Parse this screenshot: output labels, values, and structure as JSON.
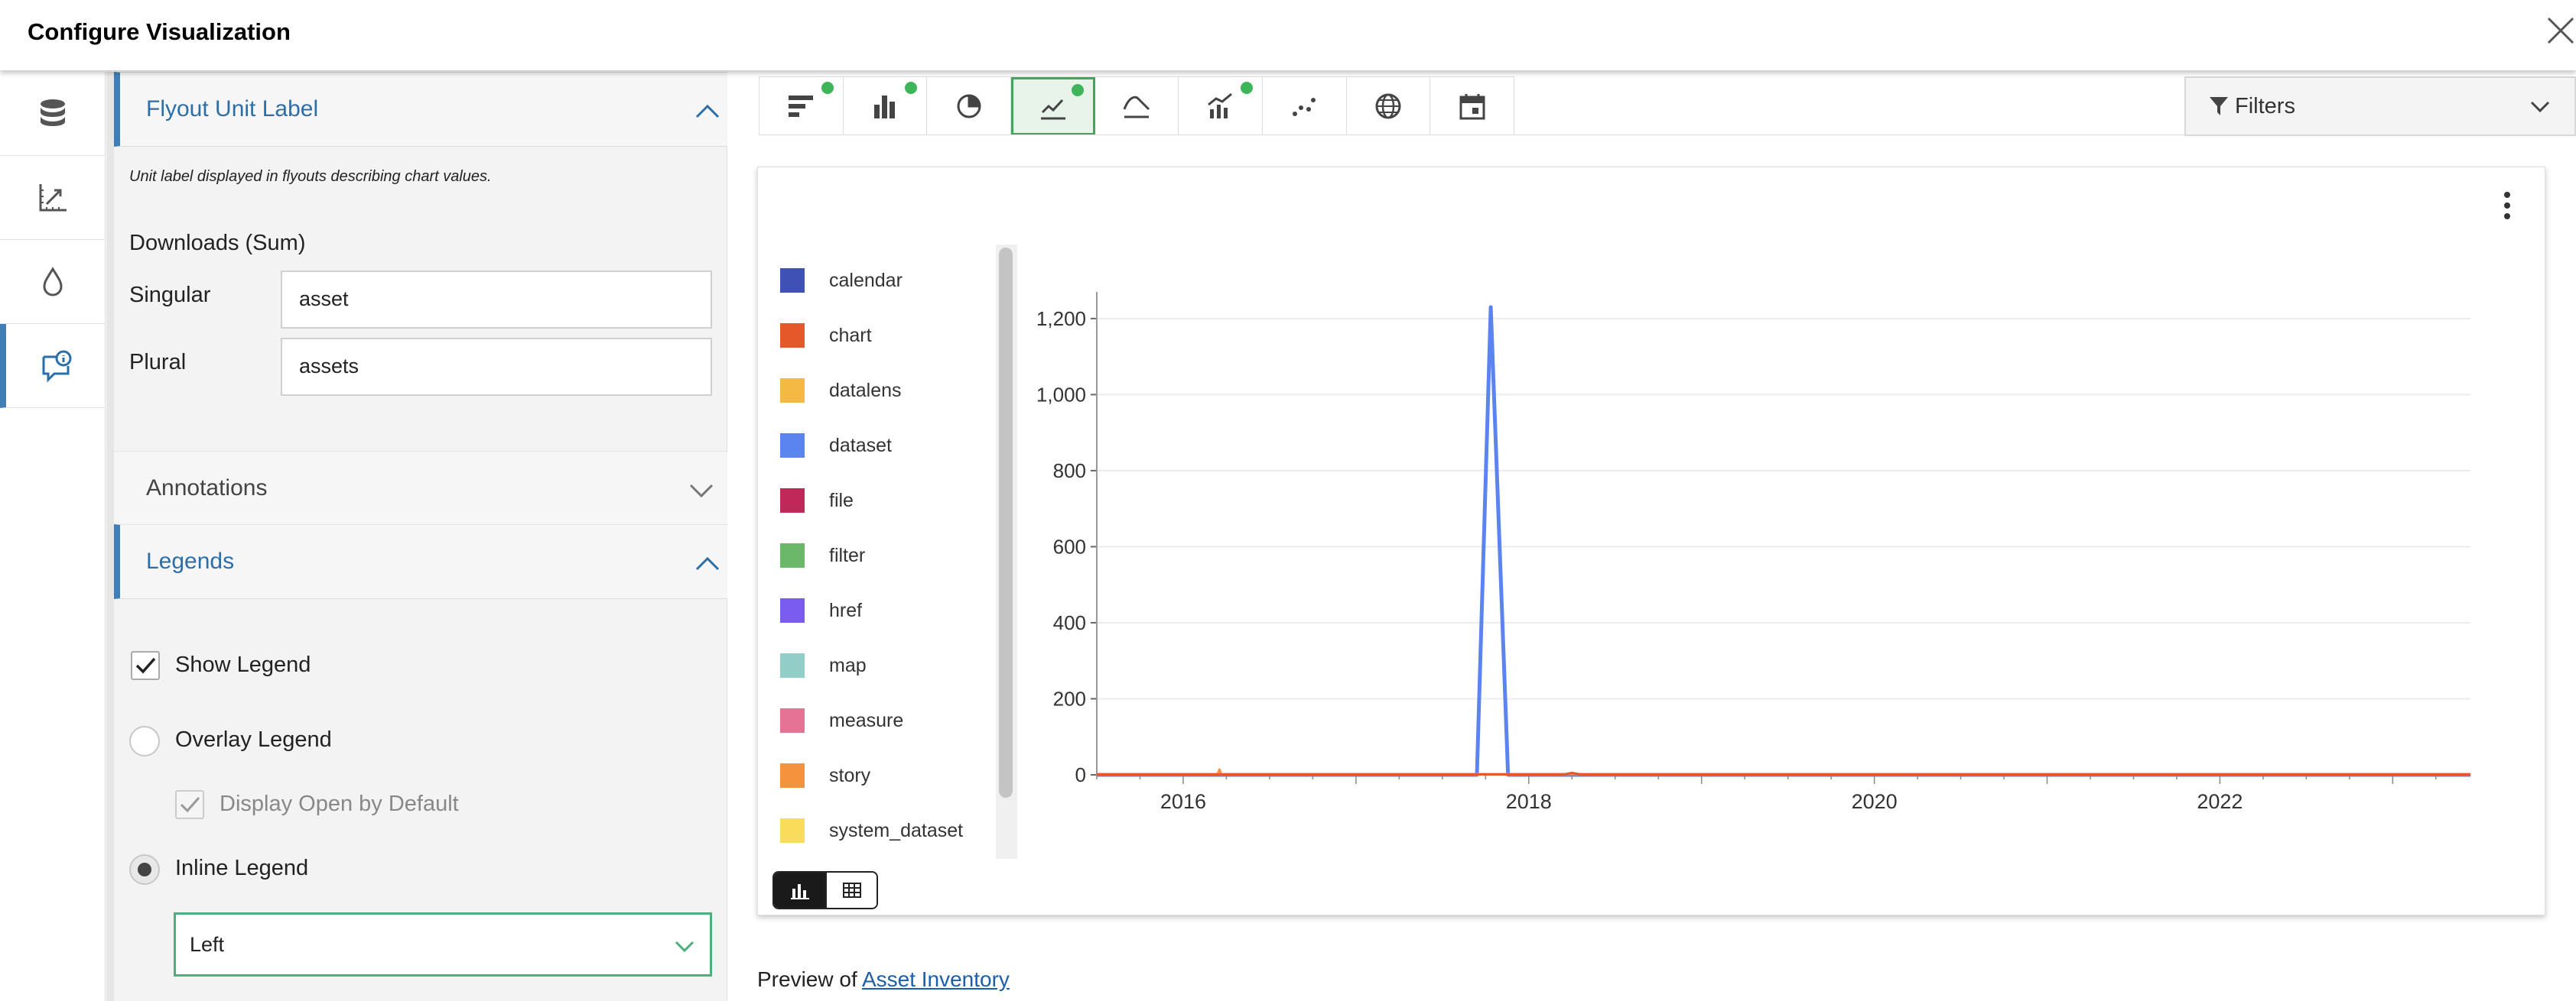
{
  "dialog": {
    "title": "Configure Visualization"
  },
  "rail": {
    "items": [
      "database-icon",
      "axis-icon",
      "drop-icon",
      "flyout-info-icon"
    ],
    "active_index": 3
  },
  "flyout_section": {
    "title": "Flyout Unit Label",
    "description": "Unit label displayed in flyouts describing chart values.",
    "measure_label": "Downloads (Sum)",
    "singular_label": "Singular",
    "singular_value": "asset",
    "plural_label": "Plural",
    "plural_value": "assets"
  },
  "annotations_section": {
    "title": "Annotations"
  },
  "legends_section": {
    "title": "Legends",
    "show_legend": {
      "label": "Show Legend",
      "checked": true
    },
    "overlay_legend": {
      "label": "Overlay Legend",
      "selected": false
    },
    "display_open": {
      "label": "Display Open by Default",
      "checked": true,
      "disabled": true
    },
    "inline_legend": {
      "label": "Inline Legend",
      "selected": true
    },
    "position_select": {
      "value": "Left"
    }
  },
  "toolbar": {
    "types": [
      {
        "icon": "horizontal-bar-icon",
        "has_data": true
      },
      {
        "icon": "bar-chart-icon",
        "has_data": true
      },
      {
        "icon": "pie-chart-icon",
        "has_data": false
      },
      {
        "icon": "line-chart-icon",
        "has_data": true,
        "active": true
      },
      {
        "icon": "area-chart-icon",
        "has_data": false
      },
      {
        "icon": "combo-chart-icon",
        "has_data": true
      },
      {
        "icon": "scatter-chart-icon",
        "has_data": false
      },
      {
        "icon": "globe-icon",
        "has_data": false
      },
      {
        "icon": "calendar-icon",
        "has_data": false
      }
    ],
    "filters_label": "Filters"
  },
  "legend": [
    {
      "name": "calendar",
      "color": "#3f51b5"
    },
    {
      "name": "chart",
      "color": "#e5582a"
    },
    {
      "name": "datalens",
      "color": "#f4b942"
    },
    {
      "name": "dataset",
      "color": "#5b84f0"
    },
    {
      "name": "file",
      "color": "#c0285a"
    },
    {
      "name": "filter",
      "color": "#6bb86a"
    },
    {
      "name": "href",
      "color": "#7a5cf0"
    },
    {
      "name": "map",
      "color": "#93cdc8"
    },
    {
      "name": "measure",
      "color": "#e57395"
    },
    {
      "name": "story",
      "color": "#f5923e"
    },
    {
      "name": "system_dataset",
      "color": "#f8dc5a"
    }
  ],
  "chart_data": {
    "type": "line",
    "title": "",
    "xlabel": "",
    "ylabel": "",
    "xlim": [
      2015.5,
      2023.45
    ],
    "ylim": [
      0,
      1250
    ],
    "xticks": [
      2016,
      2018,
      2020,
      2022
    ],
    "yticks": [
      0,
      200,
      400,
      600,
      800,
      1000,
      1200
    ],
    "grid": true,
    "series": [
      {
        "name": "dataset",
        "color": "#5b84f0",
        "x": [
          2015.5,
          2017.7,
          2017.78,
          2017.88,
          2023.45
        ],
        "y": [
          0,
          0,
          1230,
          0,
          0
        ]
      },
      {
        "name": "story",
        "color": "#f5923e",
        "x": [
          2015.5,
          2016.2,
          2016.21,
          2016.22,
          2023.45
        ],
        "y": [
          2,
          2,
          14,
          2,
          2
        ]
      },
      {
        "name": "chart",
        "color": "#e5582a",
        "x": [
          2015.5,
          2018.2,
          2018.25,
          2018.3,
          2023.45
        ],
        "y": [
          1,
          1,
          5,
          1,
          1
        ]
      }
    ]
  },
  "view_toggle": [
    "chart-view-icon",
    "table-view-icon"
  ],
  "preview": {
    "prefix": "Preview of ",
    "link": "Asset Inventory"
  }
}
